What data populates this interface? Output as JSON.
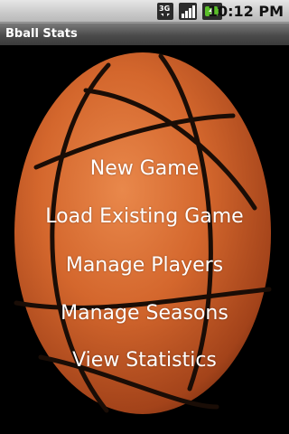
{
  "status_bar": {
    "time": "10:12 PM",
    "network_icon": "3g-data-icon",
    "signal_icon": "signal-strength-icon",
    "battery_icon": "battery-charging-icon"
  },
  "app": {
    "title": "Bball Stats"
  },
  "background": {
    "icon": "basketball-icon",
    "ball_color": "#d4672d",
    "seam_color": "#1a0d06"
  },
  "menu": {
    "items": [
      {
        "label": "New Game"
      },
      {
        "label": "Load Existing Game"
      },
      {
        "label": "Manage Players"
      },
      {
        "label": "Manage Seasons"
      },
      {
        "label": "View Statistics"
      }
    ]
  }
}
